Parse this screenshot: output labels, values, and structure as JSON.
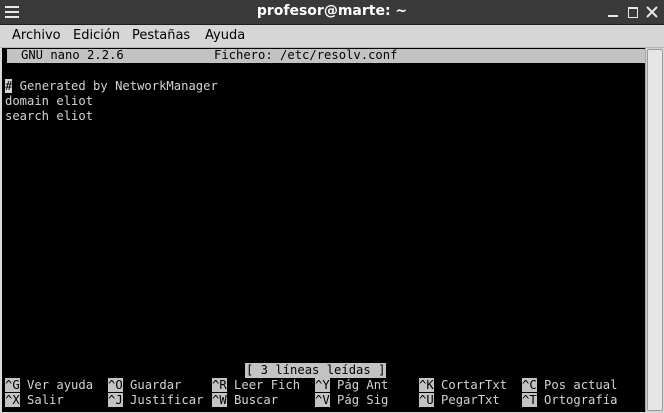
{
  "window": {
    "title": "profesor@marte: ~"
  },
  "menubar": {
    "items": [
      "Archivo",
      "Edición",
      "Pestañas",
      "Ayuda"
    ]
  },
  "nano": {
    "version": "GNU nano 2.2.6",
    "file_label": "Fichero: /etc/resolv.conf",
    "lines": [
      {
        "cursor_char": "#",
        "rest": " Generated by NetworkManager"
      },
      {
        "cursor_char": "",
        "rest": "domain eliot"
      },
      {
        "cursor_char": "",
        "rest": "search eliot"
      }
    ],
    "status": "[ 3 líneas leídas ]",
    "shortcuts_row1": [
      {
        "key": "^G",
        "label": "Ver ayuda"
      },
      {
        "key": "^O",
        "label": "Guardar"
      },
      {
        "key": "^R",
        "label": "Leer Fich"
      },
      {
        "key": "^Y",
        "label": "Pág Ant"
      },
      {
        "key": "^K",
        "label": "CortarTxt"
      },
      {
        "key": "^C",
        "label": "Pos actual"
      }
    ],
    "shortcuts_row2": [
      {
        "key": "^X",
        "label": "Salir"
      },
      {
        "key": "^J",
        "label": "Justificar"
      },
      {
        "key": "^W",
        "label": "Buscar"
      },
      {
        "key": "^V",
        "label": "Pág Sig"
      },
      {
        "key": "^U",
        "label": "PegarTxt"
      },
      {
        "key": "^T",
        "label": "Ortografía"
      }
    ]
  },
  "colors": {
    "terminal_bg": "#000000",
    "terminal_fg": "#d3d3d3",
    "highlight_bg": "#c3c3c3",
    "titlebar_bg": "#3a3a3a"
  }
}
